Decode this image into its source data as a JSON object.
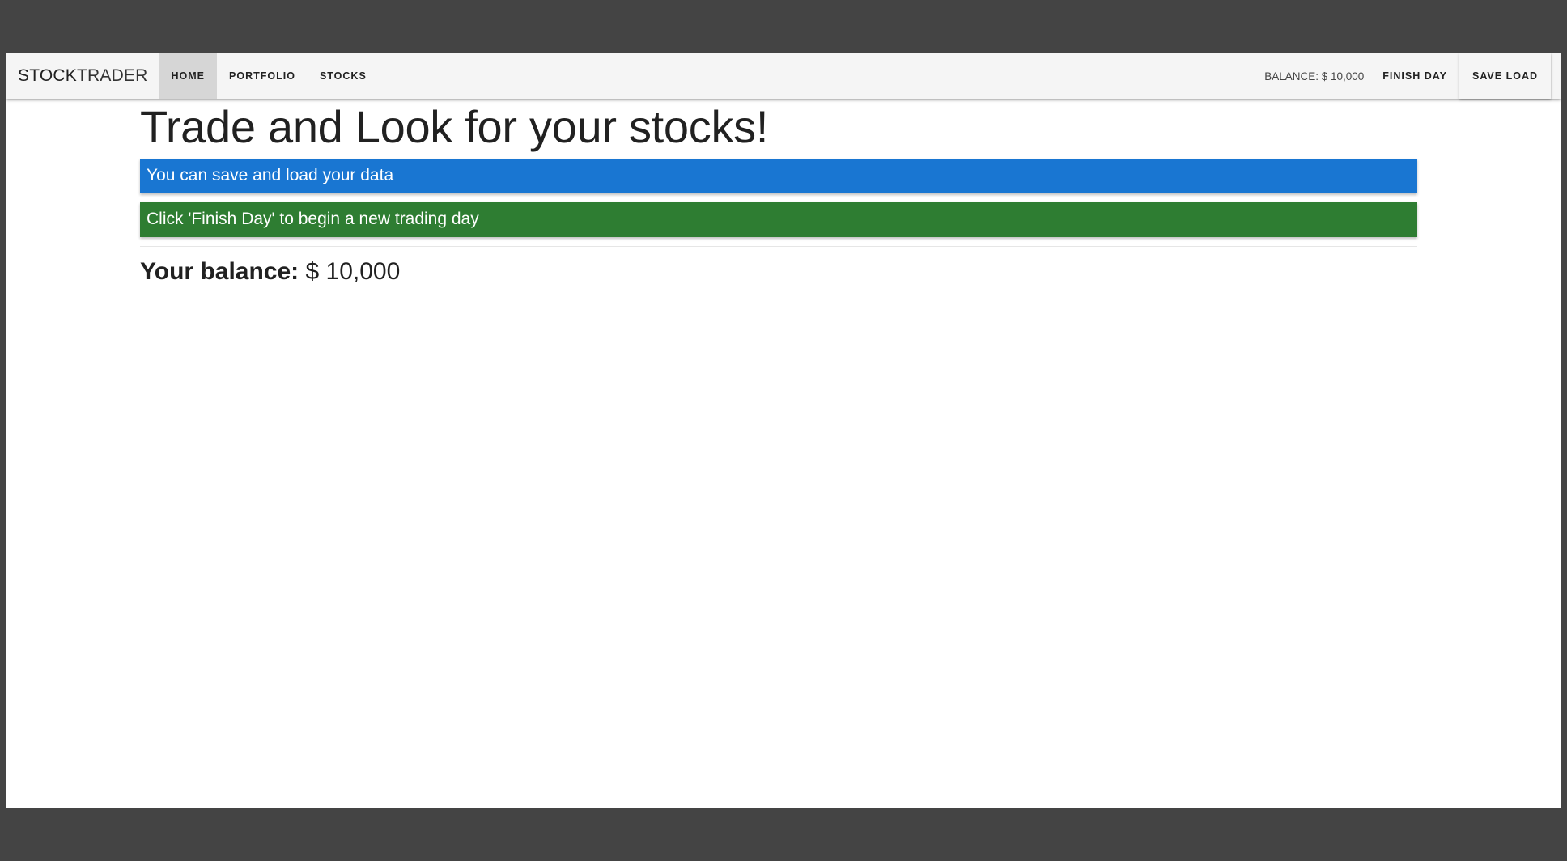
{
  "navbar": {
    "brand_strong": "STOCK",
    "brand_light": "TRADER",
    "links": [
      {
        "label": "HOME",
        "active": true
      },
      {
        "label": "PORTFOLIO",
        "active": false
      },
      {
        "label": "STOCKS",
        "active": false
      }
    ],
    "balance_label": "BALANCE: $ 10,000",
    "finish_day_label": "FINISH DAY",
    "save_load_label": "SAVE LOAD"
  },
  "main": {
    "title": "Trade and Look for your stocks!",
    "alerts": [
      {
        "text": "You can save and load your data",
        "color": "#1976d2"
      },
      {
        "text": "Click 'Finish Day' to begin a new trading day",
        "color": "#2e7d32"
      }
    ],
    "balance_label": "Your balance:",
    "balance_value": "$ 10,000"
  }
}
